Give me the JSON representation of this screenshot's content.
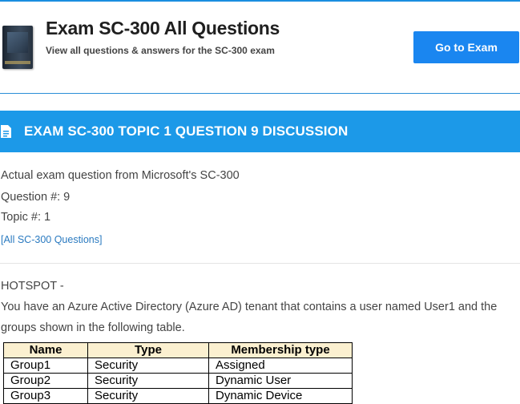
{
  "exam": {
    "title": "Exam SC-300 All Questions",
    "subtitle": "View all questions & answers for the SC-300 exam",
    "go_button": "Go to Exam",
    "icon": "exam-book-image"
  },
  "discussion": {
    "title": "EXAM SC-300 TOPIC 1 QUESTION 9 DISCUSSION",
    "icon": "document-icon"
  },
  "meta": {
    "source": "Actual exam question from Microsoft's SC-300",
    "question_no": "Question #: 9",
    "topic_no": "Topic #: 1",
    "all_link": "[All SC-300 Questions]"
  },
  "question": {
    "type": "HOTSPOT -",
    "line1": "You have an Azure Active Directory (Azure AD) tenant that contains a user named User1 and the",
    "line2": "groups shown in the following table."
  },
  "table": {
    "headers": [
      "Name",
      "Type",
      "Membership type"
    ],
    "rows": [
      [
        "Group1",
        "Security",
        "Assigned"
      ],
      [
        "Group2",
        "Security",
        "Dynamic User"
      ],
      [
        "Group3",
        "Security",
        "Dynamic Device"
      ]
    ]
  },
  "colors": {
    "accent": "#1c99e8",
    "button": "#1a86f0",
    "table_header": "#fbf0d0",
    "link": "#2a7ac0"
  }
}
